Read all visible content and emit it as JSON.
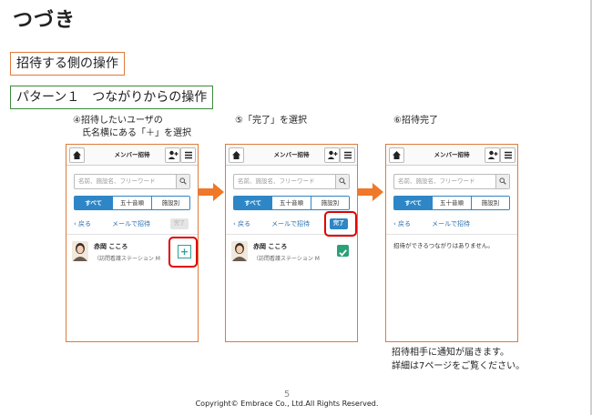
{
  "slide": {
    "title": "つづき",
    "section": "招待する側の操作",
    "pattern": "パターン１　つながりからの操作",
    "page_number": "5",
    "copyright": "Copyright© Embrace Co., Ltd.All Rights Reserved."
  },
  "steps": [
    {
      "caption_line1": "④招待したいユーザの",
      "caption_line2": "氏名横にある「＋」を選択"
    },
    {
      "caption_line1": "⑤「完了」を選択",
      "caption_line2": ""
    },
    {
      "caption_line1": "⑥招待完了",
      "caption_line2": ""
    }
  ],
  "phone": {
    "header_title": "メンバー招待",
    "home_icon": "home-icon",
    "add_user_icon": "add-user-icon",
    "menu_icon": "menu-icon",
    "search_placeholder": "名前、施設名、フリーワード",
    "tabs": [
      "すべて",
      "五十音順",
      "施設別"
    ],
    "back_label": "戻る",
    "mail_invite_label": "メールで招待",
    "done_label": "完了",
    "user_name": "赤岡 こころ",
    "user_org": "（訪問看護ステーション M",
    "add_symbol": "+",
    "empty_message": "招待ができるつながりはありません。"
  },
  "notes": [
    "招待相手に通知が届きます。",
    "詳細は7ページをご覧ください。"
  ],
  "colors": {
    "accent_blue": "#2e86c6",
    "arrow_orange": "#f07828",
    "highlight_red": "#e00000",
    "check_green": "#2aa17a"
  }
}
